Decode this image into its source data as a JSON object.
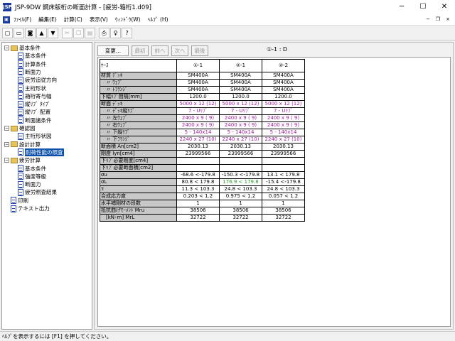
{
  "window": {
    "title": "JSP-9DW 鋼床版桁の断面計算 - [疲労-箱桁1.d09]",
    "app_icon": "JSP",
    "minimize": "─",
    "maximize": "☐",
    "close": "✕"
  },
  "menu": {
    "items": [
      "ﾌｧｲﾙ(F)",
      "編集(E)",
      "計算(C)",
      "表示(V)",
      "ｳｨﾝﾄﾞｳ(W)",
      "ﾍﾙﾌﾟ (H)"
    ],
    "mdi_min": "−",
    "mdi_restore": "❐",
    "mdi_close": "×"
  },
  "toolbar": {
    "icons": [
      "new-file-icon",
      "open-folder-icon",
      "save-icon",
      "arrow-up-icon",
      "arrow-down-icon",
      "cut-icon",
      "copy-icon",
      "paste-icon",
      "print-icon",
      "help-bulb-icon",
      "context-help-icon"
    ]
  },
  "tree": [
    {
      "label": "基本条件",
      "level": 0,
      "type": "folder",
      "tog": "-"
    },
    {
      "label": "基本条件",
      "level": 1,
      "type": "doc"
    },
    {
      "label": "計算条件",
      "level": 1,
      "type": "doc"
    },
    {
      "label": "断面力",
      "level": 1,
      "type": "doc"
    },
    {
      "label": "疲労追従方向",
      "level": 1,
      "type": "doc"
    },
    {
      "label": "主桁形状",
      "level": 1,
      "type": "doc"
    },
    {
      "label": "箱桁寄与幅",
      "level": 1,
      "type": "doc"
    },
    {
      "label": "縦ﾘﾌﾞ ﾀｲﾌﾟ",
      "level": 1,
      "type": "doc"
    },
    {
      "label": "縦ﾘﾌﾞ 配置",
      "level": 1,
      "type": "doc"
    },
    {
      "label": "断面諸条件",
      "level": 1,
      "type": "doc"
    },
    {
      "label": "確認図",
      "level": 0,
      "type": "folder",
      "tog": "-"
    },
    {
      "label": "主桁形状図",
      "level": 1,
      "type": "doc"
    },
    {
      "label": "設計計算",
      "level": 0,
      "type": "folder",
      "tog": "-"
    },
    {
      "label": "耐荷性能の照査",
      "level": 1,
      "type": "doc",
      "selected": true
    },
    {
      "label": "疲労計算",
      "level": 0,
      "type": "folder",
      "tog": "-"
    },
    {
      "label": "基本条件",
      "level": 1,
      "type": "doc"
    },
    {
      "label": "強度等級",
      "level": 1,
      "type": "doc"
    },
    {
      "label": "断面力",
      "level": 1,
      "type": "doc"
    },
    {
      "label": "疲労照査結果",
      "level": 1,
      "type": "doc"
    },
    {
      "label": "印刷",
      "level": 0,
      "type": "doc"
    },
    {
      "label": "テキスト出力",
      "level": 0,
      "type": "doc"
    }
  ],
  "nav": {
    "change": "変更...",
    "first": "最初",
    "prev": "前へ",
    "next": "次へ",
    "last": "最後"
  },
  "case_label": "①-1 : D",
  "table": {
    "headers": [
      "ｹｰｽ",
      "①-1",
      "②-1",
      "②-2"
    ],
    "rows": [
      {
        "label": "材質 ﾃﾞｯｷ",
        "indent": false,
        "cells": [
          "SM400A",
          "SM400A",
          "SM400A"
        ]
      },
      {
        "label": "〃  ｳｪﾌﾞ",
        "indent": true,
        "cells": [
          "SM400A",
          "SM400A",
          "SM400A"
        ]
      },
      {
        "label": "〃  ﾄﾌﾗﾝｼﾞ",
        "indent": true,
        "cells": [
          "SM400A",
          "SM400A",
          "SM400A"
        ]
      },
      {
        "label": "下幅ﾘﾌﾞ間隔[mm]",
        "indent": false,
        "cells": [
          "1200.0",
          "1200.0",
          "1200.0"
        ]
      },
      {
        "label": "断面 ﾃﾞｯｷ",
        "indent": false,
        "color": "mag",
        "cells": [
          "5000 x 12 (12)",
          "5000 x 12 (12)",
          "5000 x 12 (12)"
        ]
      },
      {
        "label": "〃  ﾃﾞｯｷ縦ﾘﾌﾞ",
        "indent": true,
        "color": "mag",
        "cells": [
          "7 - Uﾘﾌﾞ",
          "7 - Uﾘﾌﾞ",
          "7 - Uﾘﾌﾞ"
        ]
      },
      {
        "label": "〃  左ｳｪﾌﾞ",
        "indent": true,
        "color": "mag",
        "cells": [
          "2400 x  9 ( 9)",
          "2400 x  9 ( 9)",
          "2400 x  9 ( 9)"
        ]
      },
      {
        "label": "〃  右ｳｪﾌﾞ",
        "indent": true,
        "color": "mag",
        "cells": [
          "2400 x  9 ( 9)",
          "2400 x  9 ( 9)",
          "2400 x  9 ( 9)"
        ]
      },
      {
        "label": "〃  下縦ﾘﾌﾞ",
        "indent": true,
        "color": "mag",
        "cells": [
          "5 - 140x14",
          "5 - 140x14",
          "5 - 140x14"
        ]
      },
      {
        "label": "〃  下ﾌﾗﾝｼﾞ",
        "indent": true,
        "color": "mag",
        "cells": [
          "2240 x 27 (10)",
          "2240 x 27 (10)",
          "2240 x 27 (10)"
        ]
      },
      {
        "label": "断面積 An[cm2]",
        "indent": false,
        "cells": [
          "2030.13",
          "2030.13",
          "2030.13"
        ]
      },
      {
        "label": "剛度  Iyn[cm4]",
        "indent": false,
        "cells": [
          "23999566",
          "23999566",
          "23999566"
        ]
      },
      {
        "label": "下ﾘﾌﾞ必要剛度[cm4]",
        "indent": false,
        "blank": true,
        "cells": [
          "",
          "",
          ""
        ]
      },
      {
        "label": "下ﾘﾌﾞ必要断面積[cm2]",
        "indent": false,
        "blank": true,
        "cells": [
          "",
          "",
          ""
        ]
      },
      {
        "label": "σu",
        "indent": false,
        "cells": [
          "-68.6 <-179.8",
          "-150.3 <-179.8",
          "13.1 < 179.8"
        ]
      },
      {
        "label": "σL",
        "indent": false,
        "cells": [
          "80.8 < 179.8",
          "176.9 < 179.8",
          "-15.4 <-179.8"
        ],
        "green": 1
      },
      {
        "label": "τ",
        "indent": false,
        "cells": [
          "11.3 < 103.3",
          "24.8 < 103.3",
          "24.8 < 103.3"
        ]
      },
      {
        "label": "合成応力度",
        "indent": false,
        "cells": [
          "0.203 < 1.2",
          "0.975 < 1.2",
          "0.057 < 1.2"
        ]
      },
      {
        "label": "水平補剛材の段数",
        "indent": false,
        "cells": [
          "1",
          "1",
          "1"
        ]
      },
      {
        "label": "抵抗曲げﾓｰﾒﾝﾄ  Mru",
        "indent": false,
        "cells": [
          "38506",
          "38506",
          "38506"
        ]
      },
      {
        "label": "[kN･m]   MrL",
        "indent": true,
        "cells": [
          "32722",
          "32722",
          "32722"
        ]
      }
    ]
  },
  "status": "ﾍﾙﾌﾟを表示するには [F1] を押してください。"
}
